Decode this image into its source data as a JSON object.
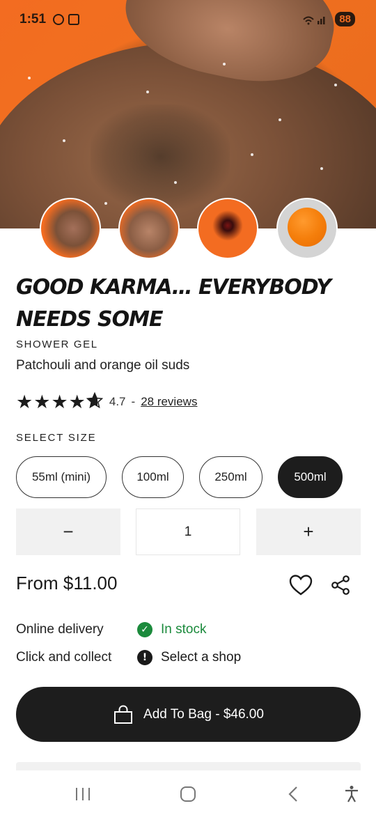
{
  "status_bar": {
    "time": "1:51",
    "battery": "88",
    "icons": [
      "alarm-icon",
      "screenshot-icon",
      "wifi-icon",
      "signal-icon"
    ]
  },
  "gallery": {
    "thumbnails": [
      "product-photo-1",
      "product-photo-2",
      "product-photo-3",
      "product-photo-4"
    ],
    "selected_index": 3
  },
  "product": {
    "title": "Good Karma… Everybody Needs Some",
    "category": "Shower Gel",
    "subtitle": "Patchouli and orange oil suds",
    "rating": {
      "stars": 4.7,
      "value": "4.7",
      "separator": "-",
      "reviews": "28 reviews"
    }
  },
  "size": {
    "label": "Select Size",
    "options": [
      "55ml (mini)",
      "100ml",
      "250ml",
      "500ml"
    ],
    "selected": "500ml"
  },
  "quantity": {
    "decrease": "−",
    "value": "1",
    "increase": "+"
  },
  "price": {
    "text": "From $11.00"
  },
  "availability": {
    "online_label": "Online delivery",
    "online_status": "In stock",
    "collect_label": "Click and collect",
    "collect_status": "Select a shop"
  },
  "cta": {
    "label": "Add To Bag - $46.00"
  },
  "colors": {
    "accent_orange": "#f36c21",
    "in_stock_green": "#1b8a3c",
    "dark": "#1d1d1d"
  }
}
